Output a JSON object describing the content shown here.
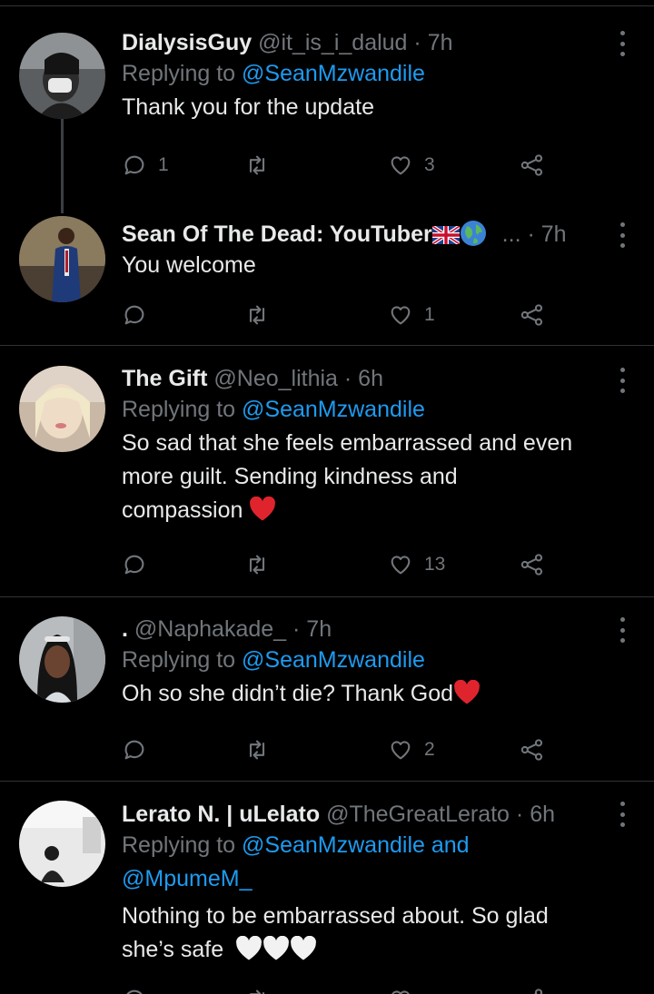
{
  "colors": {
    "background": "#000000",
    "text": "#e7e9ea",
    "muted": "#71767b",
    "link": "#1d9bf0",
    "heart": "#f91880"
  },
  "tweets": [
    {
      "name": "DialysisGuy",
      "handle": "@it_is_i_dalud",
      "time": "· 7h",
      "replying_prefix": "Replying to",
      "replying_to": "@SeanMzwandile",
      "text": "Thank you for the update",
      "replies": "1",
      "retweets": "",
      "likes": "3"
    },
    {
      "name": "Sean Of The Dead: YouTuber",
      "name_emojis": [
        "uk-flag-icon",
        "globe-icon"
      ],
      "handle": "...",
      "time": "· 7h",
      "text": "You welcome",
      "replies": "",
      "retweets": "",
      "likes": "1"
    },
    {
      "name": "The Gift",
      "handle": "@Neo_lithia",
      "time": "· 6h",
      "replying_prefix": "Replying to",
      "replying_to": "@SeanMzwandile",
      "text_lines": [
        "So sad that she feels embarrassed and even",
        "more guilt. Sending kindness and",
        "compassion"
      ],
      "text_emoji": "red-heart-icon",
      "replies": "",
      "retweets": "",
      "likes": "13"
    },
    {
      "name": ".",
      "handle": "@Naphakade_",
      "time": "· 7h",
      "replying_prefix": "Replying to",
      "replying_to": "@SeanMzwandile",
      "text": "Oh so she didn’t die? Thank God",
      "text_emoji": "red-heart-icon",
      "replies": "",
      "retweets": "",
      "likes": "2"
    },
    {
      "name": "Lerato N. | uLelato",
      "handle": "@TheGreatLerato",
      "time": "· 6h",
      "replying_prefix": "Replying to",
      "replying_to": "@SeanMzwandile",
      "replying_and": "and",
      "replying_to_2": "@MpumeM_",
      "text_lines": [
        "Nothing to be embarrassed about. So glad",
        "she’s safe"
      ],
      "text_emoji": "white-heart-icon"
    }
  ]
}
